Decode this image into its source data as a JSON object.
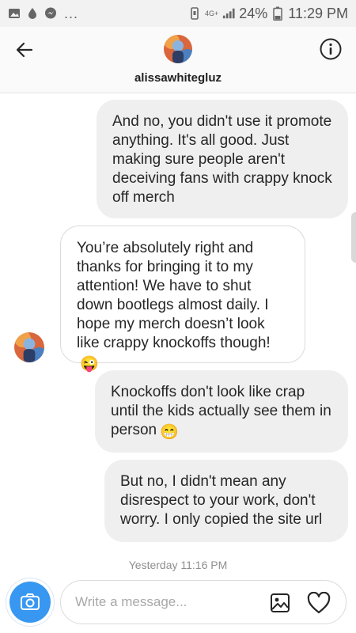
{
  "status_bar": {
    "network": "4G+",
    "battery": "24%",
    "time": "11:29 PM"
  },
  "header": {
    "username": "alissawhitegluz"
  },
  "messages": [
    {
      "side": "sent",
      "text": "And no, you didn't use it promote anything. It's all good. Just making sure people aren't deceiving fans with crappy knock off merch"
    },
    {
      "side": "received",
      "text": "You’re absolutely right and thanks for bringing it to my attention! We have to shut down bootlegs almost daily. I hope my merch doesn’t look like crappy knockoffs though!",
      "emoji": "😜"
    },
    {
      "side": "sent",
      "text": "Knockoffs don't look like crap until the kids actually see them in person",
      "emoji": "😁"
    },
    {
      "side": "sent",
      "text": "But no, I didn't mean any disrespect to your work, don't worry. I only copied the site url"
    }
  ],
  "timestamp": "Yesterday 11:16 PM",
  "composer": {
    "placeholder": "Write a message..."
  },
  "colors": {
    "camera_button": "#3897f0",
    "sent_bubble": "#efefef",
    "received_border": "#dbdbdb"
  }
}
